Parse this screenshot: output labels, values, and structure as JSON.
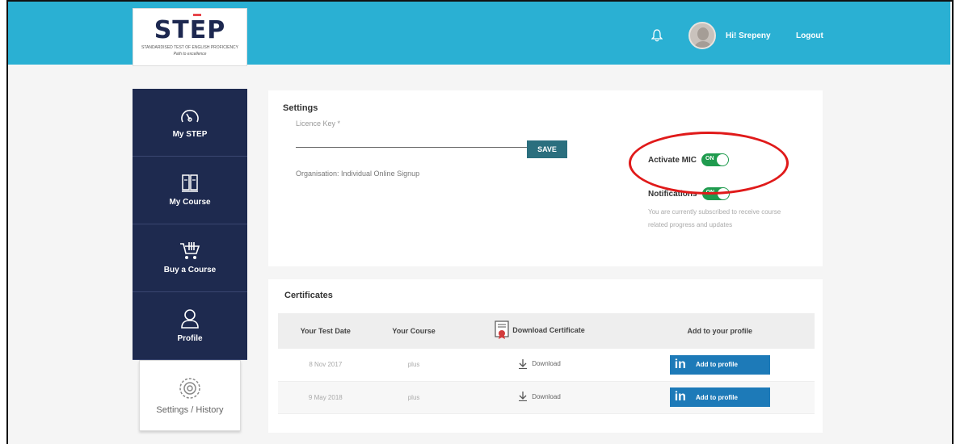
{
  "header": {
    "logo_text_1": "ST",
    "logo_text_2": "E",
    "logo_text_3": "P",
    "logo_tagline": "STANDARDISED TEST OF ENGLISH PROFICIENCY",
    "logo_tagline2": "Path to excellence",
    "greeting": "Hi! Srepeny",
    "logout_label": "Logout",
    "accent_color": "#2ab0d3"
  },
  "sidebar": {
    "items": [
      {
        "label": "My STEP",
        "icon": "gauge-icon"
      },
      {
        "label": "My Course",
        "icon": "book-icon"
      },
      {
        "label": "Buy a Course",
        "icon": "cart-icon"
      },
      {
        "label": "Profile",
        "icon": "user-icon"
      },
      {
        "label": "Settings / History",
        "icon": "settings-icon"
      }
    ],
    "color": "#1e2a4f"
  },
  "settings": {
    "title": "Settings",
    "licence_label": "Licence Key *",
    "licence_value": "",
    "save_label": "SAVE",
    "organisation": "Organisation: Individual Online Signup",
    "mic_label": "Activate MIC",
    "mic_state": "ON",
    "notifications_label": "Notifications",
    "notifications_state": "ON",
    "notifications_desc": "You are currently subscribed to receive course related progress and updates"
  },
  "certificates": {
    "title": "Certificates",
    "columns": [
      "Your Test Date",
      "Your Course",
      "Download Certificate",
      "Add to your profile"
    ],
    "rows": [
      {
        "date": "8 Nov 2017",
        "course": "plus",
        "download": "Download",
        "linkedin": "Add to profile"
      },
      {
        "date": "9 May 2018",
        "course": "plus",
        "download": "Download",
        "linkedin": "Add to profile"
      }
    ],
    "linkedin_logo": "in"
  }
}
